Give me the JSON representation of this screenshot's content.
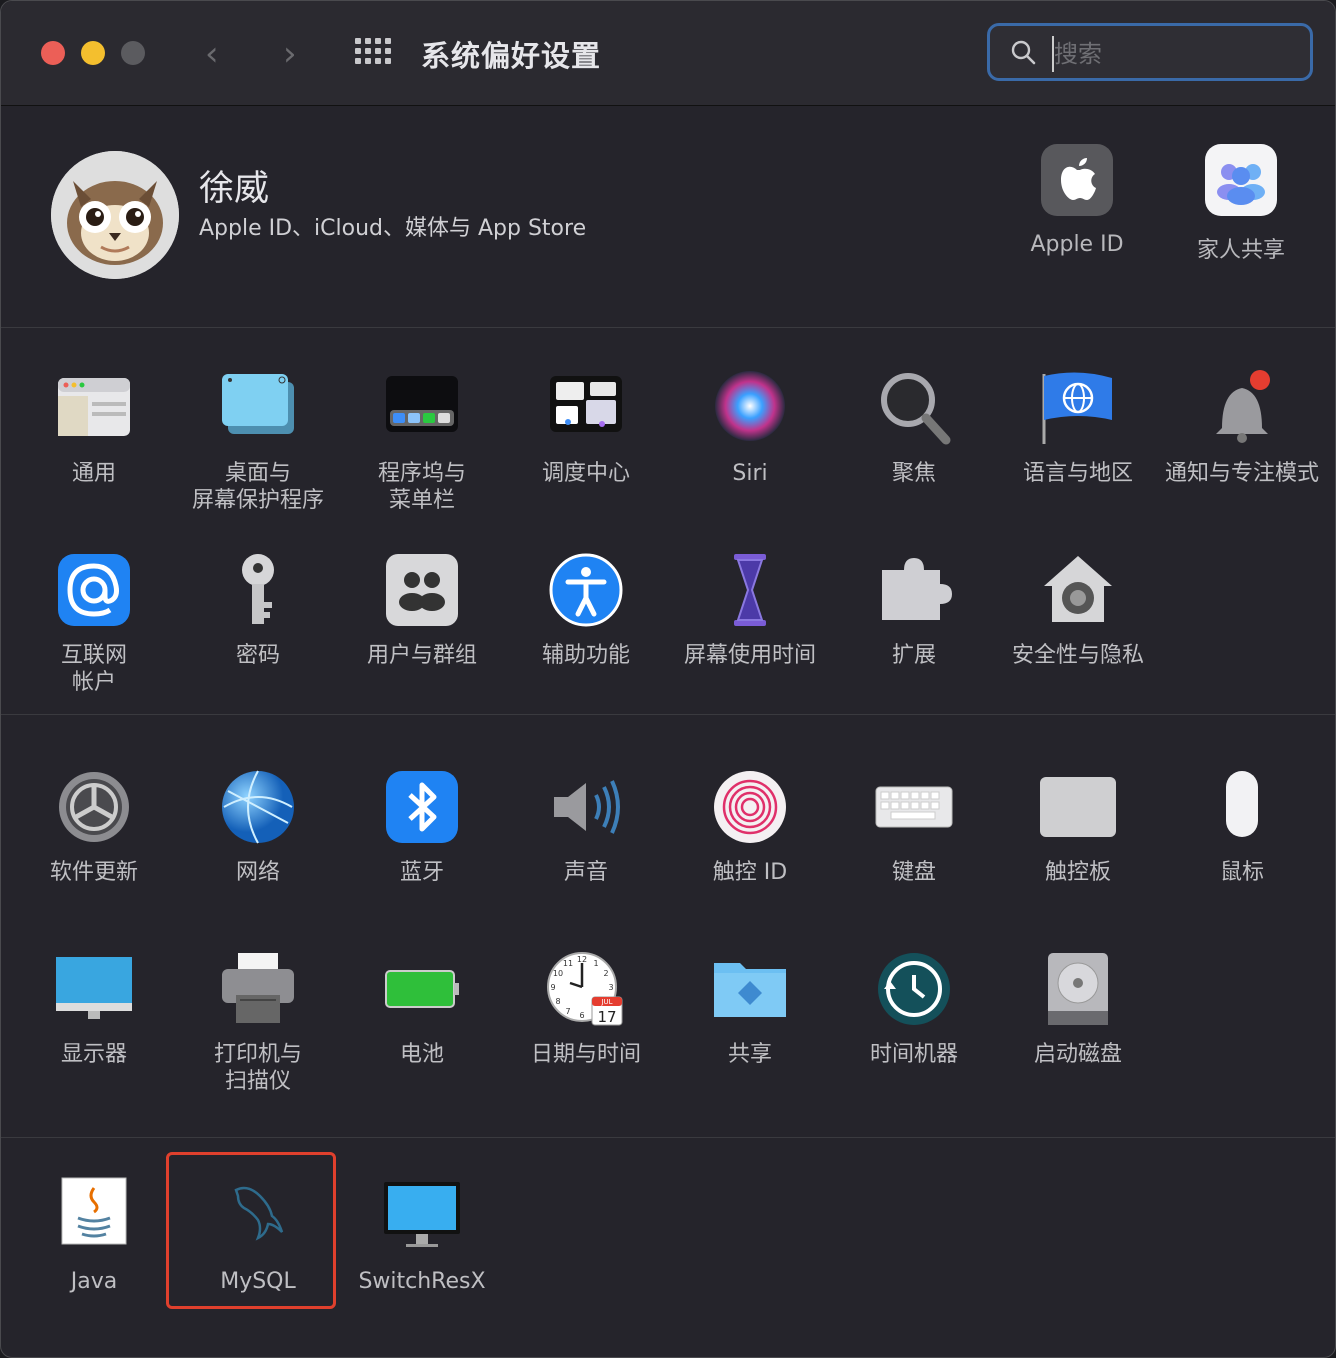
{
  "window": {
    "title": "系统偏好设置"
  },
  "traffic_lights": {
    "close": "#ec5f57",
    "minimize": "#f4bf2e",
    "zoom": "#5b5b5f"
  },
  "search": {
    "placeholder": "搜索"
  },
  "account": {
    "name": "徐威",
    "subtitle": "Apple ID、iCloud、媒体与 App Store",
    "apple_id_label": "Apple ID",
    "family_label": "家人共享"
  },
  "section1": [
    {
      "icon": "general-icon",
      "label": "通用"
    },
    {
      "icon": "desktop-screensaver-icon",
      "label": "桌面与\n屏幕保护程序"
    },
    {
      "icon": "dock-menubar-icon",
      "label": "程序坞与\n菜单栏"
    },
    {
      "icon": "mission-control-icon",
      "label": "调度中心"
    },
    {
      "icon": "siri-icon",
      "label": "Siri"
    },
    {
      "icon": "spotlight-icon",
      "label": "聚焦"
    },
    {
      "icon": "language-region-icon",
      "label": "语言与地区"
    },
    {
      "icon": "notifications-icon",
      "label": "通知与专注模式"
    },
    {
      "icon": "internet-accounts-icon",
      "label": "互联网\n帐户"
    },
    {
      "icon": "passwords-icon",
      "label": "密码"
    },
    {
      "icon": "users-groups-icon",
      "label": "用户与群组"
    },
    {
      "icon": "accessibility-icon",
      "label": "辅助功能"
    },
    {
      "icon": "screen-time-icon",
      "label": "屏幕使用时间"
    },
    {
      "icon": "extensions-icon",
      "label": "扩展"
    },
    {
      "icon": "security-privacy-icon",
      "label": "安全性与隐私"
    }
  ],
  "section2": [
    {
      "icon": "software-update-icon",
      "label": "软件更新"
    },
    {
      "icon": "network-icon",
      "label": "网络"
    },
    {
      "icon": "bluetooth-icon",
      "label": "蓝牙"
    },
    {
      "icon": "sound-icon",
      "label": "声音"
    },
    {
      "icon": "touch-id-icon",
      "label": "触控 ID"
    },
    {
      "icon": "keyboard-icon",
      "label": "键盘"
    },
    {
      "icon": "trackpad-icon",
      "label": "触控板"
    },
    {
      "icon": "mouse-icon",
      "label": "鼠标"
    },
    {
      "icon": "displays-icon",
      "label": "显示器"
    },
    {
      "icon": "printers-scanners-icon",
      "label": "打印机与\n扫描仪"
    },
    {
      "icon": "battery-icon",
      "label": "电池"
    },
    {
      "icon": "date-time-icon",
      "label": "日期与时间"
    },
    {
      "icon": "sharing-icon",
      "label": "共享"
    },
    {
      "icon": "time-machine-icon",
      "label": "时间机器"
    },
    {
      "icon": "startup-disk-icon",
      "label": "启动磁盘"
    }
  ],
  "clock": {
    "month": "JUL",
    "day": "17",
    "hours": [
      "12",
      "1",
      "2",
      "3",
      "4",
      "5",
      "6",
      "7",
      "8",
      "9",
      "10",
      "11"
    ]
  },
  "section3": [
    {
      "icon": "java-icon",
      "label": "Java"
    },
    {
      "icon": "mysql-icon",
      "label": "MySQL"
    },
    {
      "icon": "switchresx-icon",
      "label": "SwitchResX"
    }
  ]
}
